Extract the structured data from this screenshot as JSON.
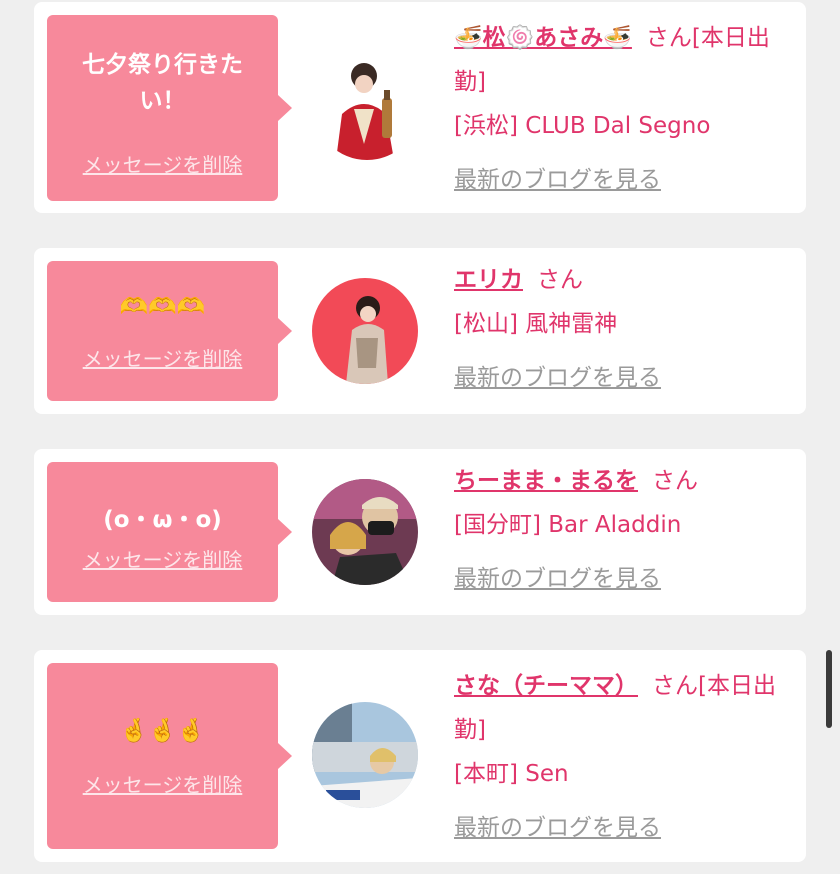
{
  "delete_label": "メッセージを削除",
  "blog_label": "最新のブログを見る",
  "san_label": "さん",
  "cards": [
    {
      "message": "七夕祭り行きたい！",
      "name": "🍜松🍥あさみ🍜",
      "tail": "[本日出勤]",
      "shop": "[浜松] CLUB Dal Segno"
    },
    {
      "message": "🫶🫶🫶",
      "name": "エリカ",
      "shop": "[松山] 風神雷神"
    },
    {
      "message": "(o・ω・o)",
      "name": "ちーまま・まるを",
      "shop": "[国分町] Bar Aladdin"
    },
    {
      "message": "🤞🤞🤞",
      "name": "さな（チーママ）",
      "tail": "[本日出勤]",
      "shop": "[本町] Sen"
    }
  ],
  "colors": {
    "accent": "#e0356b",
    "bubble": "#f7899b",
    "card": "#ffffff",
    "background": "#efefef"
  }
}
